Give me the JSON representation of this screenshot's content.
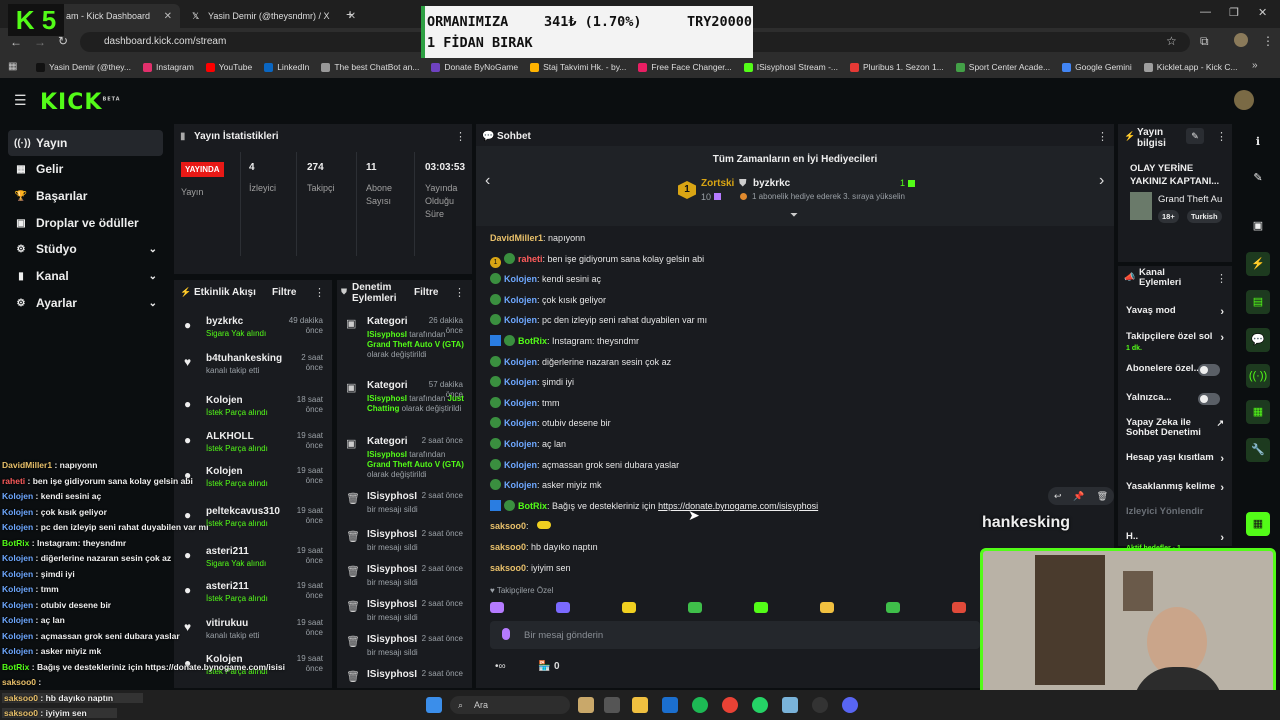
{
  "browser": {
    "tabs": [
      {
        "title": "am - Kick Dashboard"
      },
      {
        "title": "Yasin Demir (@theysndmr) / X"
      }
    ],
    "url": "dashboard.kick.com/stream",
    "bookmarks": [
      {
        "label": "Yasin Demir (@they...",
        "color": "#111111"
      },
      {
        "label": "Instagram",
        "color": "#e1306c"
      },
      {
        "label": "YouTube",
        "color": "#ff0000"
      },
      {
        "label": "LinkedIn",
        "color": "#0a66c2"
      },
      {
        "label": "The best ChatBot an...",
        "color": "#999999"
      },
      {
        "label": "Donate ByNoGame",
        "color": "#6f42c1"
      },
      {
        "label": "Staj Takvimi Hk. - by...",
        "color": "#ffb300"
      },
      {
        "label": "Free Face Changer...",
        "color": "#e91e63"
      },
      {
        "label": "ISisyphosI Stream -...",
        "color": "#53fc18"
      },
      {
        "label": "Pluribus 1. Sezon 1...",
        "color": "#e53935"
      },
      {
        "label": "Sport Center Acade...",
        "color": "#43a047"
      },
      {
        "label": "Google Gemini",
        "color": "#4285f4"
      },
      {
        "label": "Kicklet.app - Kick C...",
        "color": "#9e9e9e"
      }
    ]
  },
  "overlay_logo": "K 5",
  "donation": {
    "line1": "ORMANIMIZA",
    "amount": "341₺ (1.70%)",
    "goal": "TRY20000",
    "line2": "1 FİDAN BIRAK"
  },
  "kick": {
    "logo": "KICK",
    "logo_sup": "BETA",
    "sidebar": [
      {
        "label": "Yayın",
        "icon": "((·))"
      },
      {
        "label": "Gelir",
        "icon": "▦"
      },
      {
        "label": "Başarılar",
        "icon": "🏆"
      },
      {
        "label": "Droplar ve ödüller",
        "icon": "▣"
      },
      {
        "label": "Stüdyo",
        "icon": "⚙"
      },
      {
        "label": "Kanal",
        "icon": "▮"
      },
      {
        "label": "Ayarlar",
        "icon": "⚙"
      }
    ]
  },
  "stats": {
    "title": "Yayın İstatistikleri",
    "live_badge": "YAYINDA",
    "live_label": "Yayın",
    "items": [
      {
        "value": "4",
        "label": "İzleyici"
      },
      {
        "value": "274",
        "label": "Takipçi"
      },
      {
        "value": "11",
        "label": "Abone Sayısı"
      },
      {
        "value": "03:03:53",
        "label": "Yayında Olduğu Süre"
      }
    ]
  },
  "activity": {
    "title": "Etkinlik Akışı",
    "filter": "Filtre",
    "rows": [
      {
        "name": "byzkrkc",
        "time": "49 dakika önce",
        "desc": "Sigara Yak alındı",
        "green": true,
        "icon": "●"
      },
      {
        "name": "b4tuhankesking",
        "time": "2 saat önce",
        "desc": "kanalı takip etti",
        "green": false,
        "icon": "♥"
      },
      {
        "name": "Kolojen",
        "time": "18 saat önce",
        "desc": "İstek Parça alındı",
        "green": true,
        "icon": "●"
      },
      {
        "name": "ALKHOLL",
        "time": "19 saat önce",
        "desc": "İstek Parça alındı",
        "green": true,
        "icon": "●"
      },
      {
        "name": "Kolojen",
        "time": "19 saat önce",
        "desc": "İstek Parça alındı",
        "green": true,
        "icon": "●"
      },
      {
        "name": "peltekcavus310",
        "time": "19 saat önce",
        "desc": "İstek Parça alındı",
        "green": true,
        "icon": "●"
      },
      {
        "name": "asteri211",
        "time": "19 saat önce",
        "desc": "Sigara Yak alındı",
        "green": true,
        "icon": "●"
      },
      {
        "name": "asteri211",
        "time": "19 saat önce",
        "desc": "İstek Parça alındı",
        "green": true,
        "icon": "●"
      },
      {
        "name": "vitirukuu",
        "time": "19 saat önce",
        "desc": "kanalı takip etti",
        "green": false,
        "icon": "♥"
      },
      {
        "name": "Kolojen",
        "time": "19 saat önce",
        "desc": "İstek Parça alındı",
        "green": true,
        "icon": "●"
      }
    ]
  },
  "moderation": {
    "title": "Denetim Eylemleri",
    "filter": "Filtre",
    "rows": [
      {
        "name": "Kategori",
        "time": "26 dakika önce",
        "who": "ISisyphosI",
        "mid": "tarafından",
        "value": "Grand Theft Auto V (GTA)",
        "end": "olarak değiştirildi",
        "icon": "▣"
      },
      {
        "name": "Kategori",
        "time": "57 dakika önce",
        "who": "ISisyphosI",
        "mid": "tarafından",
        "value": "Just Chatting",
        "end": "olarak değiştirildi",
        "icon": "▣"
      },
      {
        "name": "Kategori",
        "time": "2 saat önce",
        "who": "ISisyphosI",
        "mid": "tarafından",
        "value": "Grand Theft Auto V (GTA)",
        "end": "olarak değiştirildi",
        "icon": "▣"
      },
      {
        "name": "ISisyphosI",
        "time": "2 saat önce",
        "desc": "bir mesajı sildi",
        "icon": "🗑"
      },
      {
        "name": "ISisyphosI",
        "time": "2 saat önce",
        "desc": "bir mesajı sildi",
        "icon": "🗑"
      },
      {
        "name": "ISisyphosI",
        "time": "2 saat önce",
        "desc": "bir mesajı sildi",
        "icon": "🗑"
      },
      {
        "name": "ISisyphosI",
        "time": "2 saat önce",
        "desc": "bir mesajı sildi",
        "icon": "🗑"
      },
      {
        "name": "ISisyphosI",
        "time": "2 saat önce",
        "desc": "bir mesajı sildi",
        "icon": "🗑"
      },
      {
        "name": "ISisyphosI",
        "time": "2 saat önce",
        "desc": "",
        "icon": "🗑"
      }
    ]
  },
  "chat": {
    "title": "Sohbet",
    "gifters_title": "Tüm Zamanların en İyi Hediyecileri",
    "gifter1": {
      "name": "Zortski",
      "count": "10",
      "rank": "1"
    },
    "gifter2": {
      "name": "byzkrkc",
      "count": "1",
      "promo": "1 abonelik hediye ederek 3. sıraya yükselin"
    },
    "messages": [
      {
        "user": "DavidMiller1",
        "color": "#e8c06a",
        "text": "napıyonn",
        "badges": []
      },
      {
        "user": "raheti",
        "color": "#ff5c5c",
        "text": "ben işe gidiyorum sana kolay gelsin abi",
        "badges": [
          "num",
          "emo"
        ]
      },
      {
        "user": "Kolojen",
        "color": "#6ea8ff",
        "text": "kendi sesini aç",
        "badges": [
          "emo"
        ]
      },
      {
        "user": "Kolojen",
        "color": "#6ea8ff",
        "text": "çok kısık geliyor",
        "badges": [
          "emo"
        ]
      },
      {
        "user": "Kolojen",
        "color": "#6ea8ff",
        "text": "pc den izleyip seni rahat duyabilen var mı",
        "badges": [
          "emo"
        ]
      },
      {
        "user": "BotRix",
        "color": "#53fc18",
        "text": "Instagram: theysndmr",
        "badges": [
          "bot",
          "emo"
        ]
      },
      {
        "user": "Kolojen",
        "color": "#6ea8ff",
        "text": "diğerlerine nazaran sesin çok az",
        "badges": [
          "emo"
        ]
      },
      {
        "user": "Kolojen",
        "color": "#6ea8ff",
        "text": "şimdi iyi",
        "badges": [
          "emo"
        ]
      },
      {
        "user": "Kolojen",
        "color": "#6ea8ff",
        "text": "tmm",
        "badges": [
          "emo"
        ]
      },
      {
        "user": "Kolojen",
        "color": "#6ea8ff",
        "text": "otubiv desene bir",
        "badges": [
          "emo"
        ]
      },
      {
        "user": "Kolojen",
        "color": "#6ea8ff",
        "text": "aç lan",
        "badges": [
          "emo"
        ]
      },
      {
        "user": "Kolojen",
        "color": "#6ea8ff",
        "text": "açmassan grok seni dubara yaslar",
        "badges": [
          "emo"
        ]
      },
      {
        "user": "Kolojen",
        "color": "#6ea8ff",
        "text": "asker miyiz mk",
        "badges": [
          "emo"
        ]
      },
      {
        "user": "BotRix",
        "color": "#53fc18",
        "text": "Bağış ve destekleriniz için ",
        "link": "https://donate.bynogame.com/isisyphosi",
        "badges": [
          "bot",
          "emo"
        ]
      },
      {
        "user": "saksoo0",
        "color": "#e8c06a",
        "text": "",
        "badges": []
      },
      {
        "user": "saksoo0",
        "color": "#e8c06a",
        "text": "hb dayıko naptın",
        "badges": []
      },
      {
        "user": "saksoo0",
        "color": "#e8c06a",
        "text": "iyiyim sen",
        "badges": []
      }
    ],
    "followers_only": "Takipçilere Özel",
    "input_placeholder": "Bir mesaj gönderin",
    "footer_count": "0"
  },
  "stream_info": {
    "title": "Yayın bilgisi",
    "stream_title": "OLAY YERİNE YAKINIZ KAPTANI...",
    "game": "Grand Theft Au",
    "age": "18+",
    "lang": "Turkish"
  },
  "channel_actions": {
    "title": "Kanal Eylemleri",
    "rows": [
      {
        "label": "Yavaş mod",
        "type": "arrow"
      },
      {
        "label": "Takipçilere özel sol",
        "sub": "1 dk.",
        "type": "arrow"
      },
      {
        "label": "Abonelere özel...",
        "type": "toggle"
      },
      {
        "label": "Yalnızca...",
        "type": "toggle"
      },
      {
        "label": "Yapay Zeka ile Sohbet Denetimi",
        "type": "ext"
      },
      {
        "label": "Hesap yaşı kısıtlam",
        "type": "arrow"
      },
      {
        "label": "Yasaklanmış kelime",
        "type": "arrow"
      },
      {
        "label": "İzleyici Yönlendir",
        "type": "none"
      },
      {
        "label": "H..",
        "sub": "Aktif hedefler - 1",
        "type": "arrow"
      }
    ]
  },
  "cam_name": "hankesking",
  "chat_overlay": [
    {
      "user": "DavidMiller1",
      "color": "#e8c06a",
      "text": "napıyonn"
    },
    {
      "user": "raheti",
      "color": "#ff5c5c",
      "text": "ben işe gidiyorum sana kolay gelsin abi"
    },
    {
      "user": "Kolojen",
      "color": "#6ea8ff",
      "text": "kendi sesini aç"
    },
    {
      "user": "Kolojen",
      "color": "#6ea8ff",
      "text": "çok kısık geliyor"
    },
    {
      "user": "Kolojen",
      "color": "#6ea8ff",
      "text": "pc den izleyip seni rahat duyabilen var mı"
    },
    {
      "user": "BotRix",
      "color": "#53fc18",
      "text": "Instagram: theysndmr"
    },
    {
      "user": "Kolojen",
      "color": "#6ea8ff",
      "text": "diğerlerine nazaran sesin çok az"
    },
    {
      "user": "Kolojen",
      "color": "#6ea8ff",
      "text": "şimdi iyi"
    },
    {
      "user": "Kolojen",
      "color": "#6ea8ff",
      "text": "tmm"
    },
    {
      "user": "Kolojen",
      "color": "#6ea8ff",
      "text": "otubiv desene bir"
    },
    {
      "user": "Kolojen",
      "color": "#6ea8ff",
      "text": "aç lan"
    },
    {
      "user": "Kolojen",
      "color": "#6ea8ff",
      "text": "açmassan grok seni dubara yaslar"
    },
    {
      "user": "Kolojen",
      "color": "#6ea8ff",
      "text": "asker miyiz mk"
    },
    {
      "user": "BotRix",
      "color": "#53fc18",
      "text": "Bağış ve destekleriniz için https://donate.bynogame.com/isisi"
    },
    {
      "user": "saksoo0",
      "color": "#e8c06a",
      "text": ""
    },
    {
      "user": "saksoo0",
      "color": "#e8c06a",
      "text": "hb dayıko naptın"
    },
    {
      "user": "saksoo0",
      "color": "#e8c06a",
      "text": "iyiyim sen"
    }
  ],
  "taskbar": {
    "search": "Ara"
  },
  "colors": {
    "accent": "#53fc18",
    "live": "#e91916",
    "panel": "#191b1f",
    "bg": "#0b0e10"
  }
}
